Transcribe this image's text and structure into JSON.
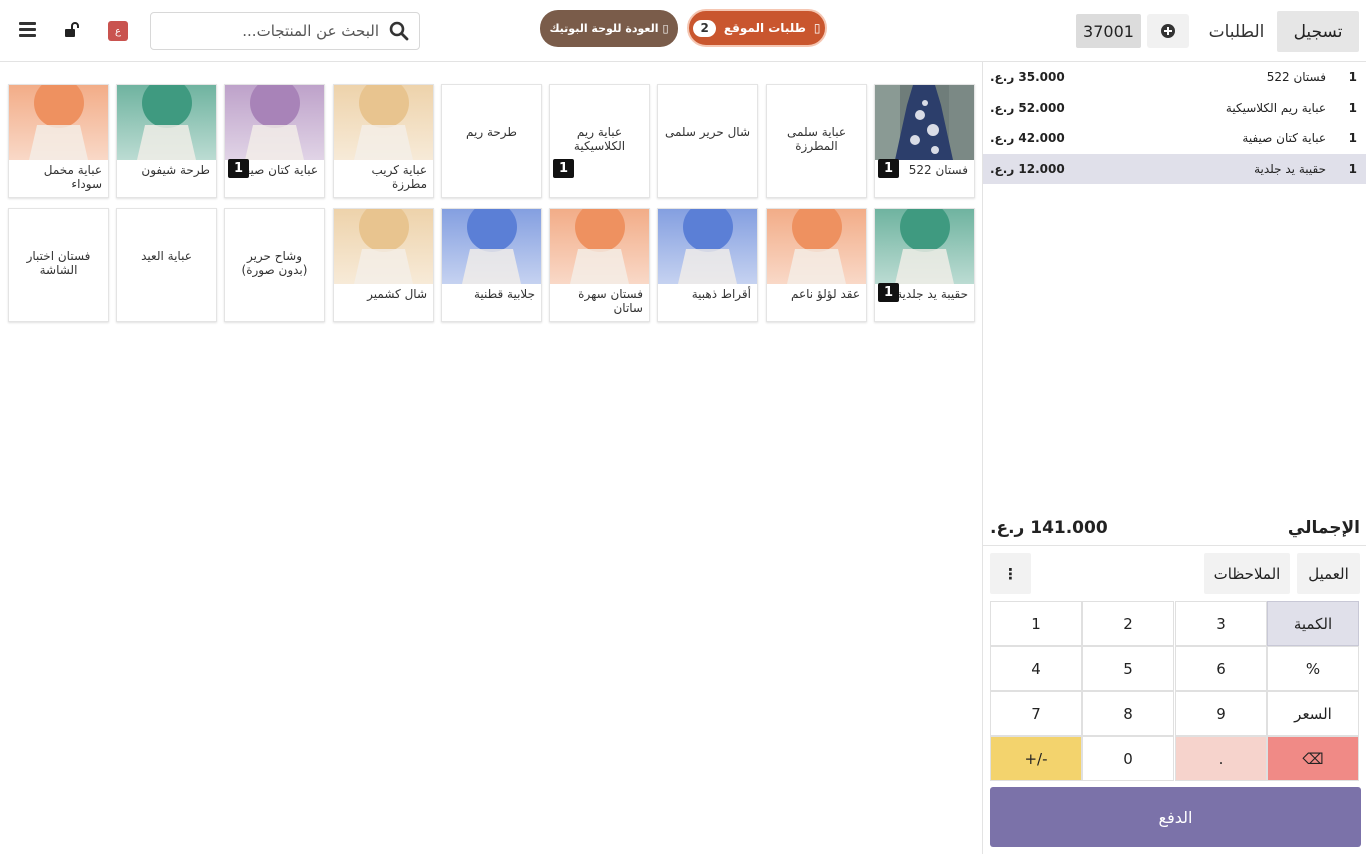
{
  "header": {
    "register_label": "تسجيل",
    "orders_label": "الطلبات",
    "add_order_icon": "plus-circle-icon",
    "current_order": "37001",
    "site_orders_label": "طلبات الموقع",
    "site_orders_count": "2",
    "site_orders_icon": "▯",
    "back_label": "العودة للوحة البوتيك",
    "back_icon": "▯",
    "search_placeholder": "البحث عن المنتجات...",
    "lang_badge": "ع",
    "colors": {
      "site_orders": "#c9562e",
      "back": "#7a5c4a",
      "lang": "#c9534f"
    }
  },
  "products_row1": [
    {
      "name": "فستان 522",
      "qty": "1",
      "thumb": "photo"
    },
    {
      "name": "عباية سلمى المطرزة",
      "qty": "",
      "thumb": "none"
    },
    {
      "name": "شال حرير سلمى",
      "qty": "",
      "thumb": "none"
    },
    {
      "name": "عباية ريم الكلاسيكية",
      "qty": "1",
      "thumb": "none"
    },
    {
      "name": "طرحة ريم",
      "qty": "",
      "thumb": "none"
    },
    {
      "name": "عباية كريب مطرزة",
      "qty": "",
      "thumb": "#e8c48f"
    },
    {
      "name": "عباية كتان صيفية",
      "qty": "1",
      "thumb": "#a883b8"
    },
    {
      "name": "طرحة شيفون",
      "qty": "",
      "thumb": "#3f9a80"
    },
    {
      "name": "عباية مخمل سوداء",
      "qty": "",
      "thumb": "#ee9160"
    }
  ],
  "products_row2": [
    {
      "name": "حقيبة يد جلدية",
      "qty": "1",
      "thumb": "#3f9a80"
    },
    {
      "name": "عقد لؤلؤ ناعم",
      "qty": "",
      "thumb": "#ee9160"
    },
    {
      "name": "أقراط ذهبية",
      "qty": "",
      "thumb": "#5b7fd6"
    },
    {
      "name": "فستان سهرة ساتان",
      "qty": "",
      "thumb": "#ee9160"
    },
    {
      "name": "جلابية قطنية",
      "qty": "",
      "thumb": "#5b7fd6"
    },
    {
      "name": "شال كشمير",
      "qty": "",
      "thumb": "#e8c48f"
    },
    {
      "name": "وشاح حرير (بدون صورة)",
      "qty": "",
      "thumb": "none"
    },
    {
      "name": "عباية العيد",
      "qty": "",
      "thumb": "none"
    },
    {
      "name": "فستان اختبار الشاشة",
      "qty": "",
      "thumb": "none"
    }
  ],
  "order_lines": [
    {
      "qty": "1",
      "name": "فستان 522",
      "price": "35.000 ر.ع."
    },
    {
      "qty": "1",
      "name": "عباية ريم الكلاسيكية",
      "price": "52.000 ر.ع."
    },
    {
      "qty": "1",
      "name": "عباية كتان صيفية",
      "price": "42.000 ر.ع."
    },
    {
      "qty": "1",
      "name": "حقيبة يد جلدية",
      "price": "12.000 ر.ع.",
      "selected": true
    }
  ],
  "total": {
    "label": "الإجمالي",
    "value": "141.000 ر.ع."
  },
  "controls": {
    "customer": "العميل",
    "notes": "الملاحظات",
    "more": "⋮"
  },
  "numpad": {
    "k1": "1",
    "k2": "2",
    "k3": "3",
    "qty": "الكمية",
    "k4": "4",
    "k5": "5",
    "k6": "6",
    "pct": "%",
    "k7": "7",
    "k8": "8",
    "k9": "9",
    "price": "السعر",
    "pm": "+/-",
    "k0": "0",
    "dot": ".",
    "bs": "⌫"
  },
  "pay_label": "الدفع"
}
